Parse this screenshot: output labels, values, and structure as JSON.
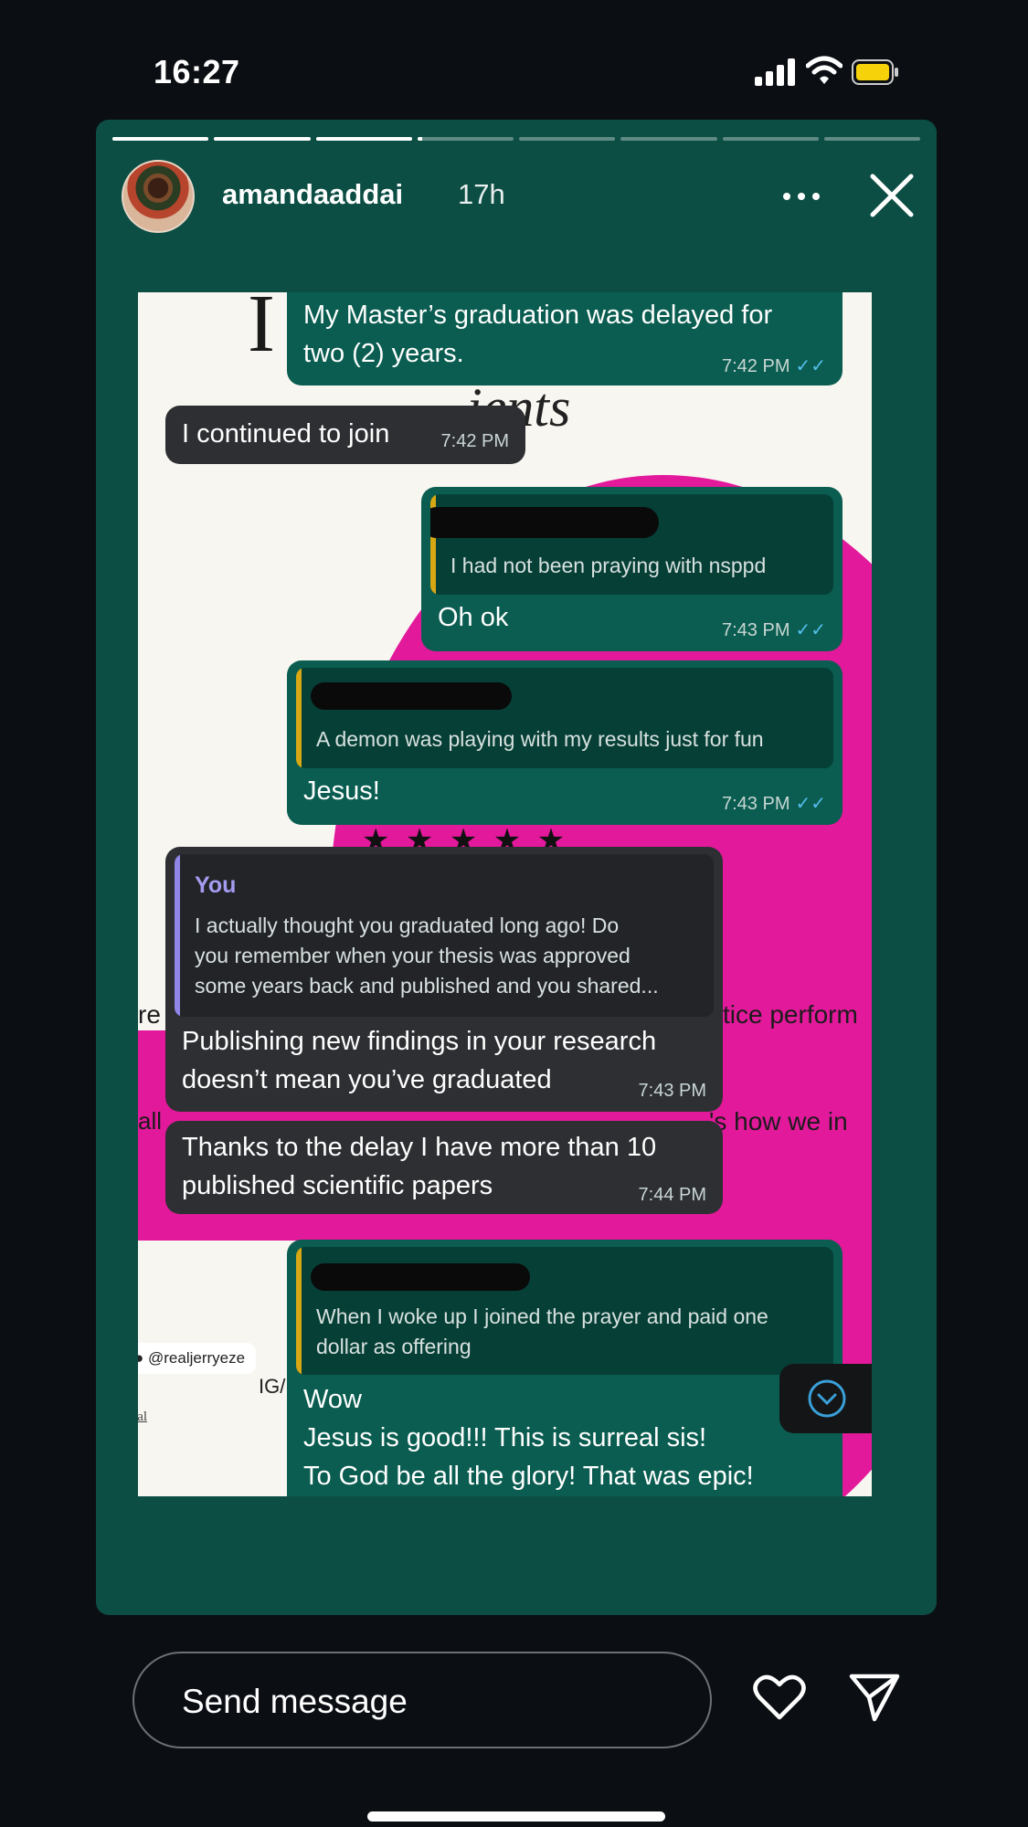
{
  "status_bar": {
    "time": "16:27"
  },
  "story": {
    "progress": {
      "segments": 8,
      "current_segment": 4,
      "current_fraction": 0.05
    },
    "username": "amandaaddai",
    "time_ago": "17h"
  },
  "chat": {
    "messages": [
      {
        "direction": "outgoing",
        "text_lines": [
          "My Master’s graduation was delayed for",
          "two (2) years."
        ],
        "time": "7:42 PM",
        "read": true
      },
      {
        "direction": "incoming",
        "text_lines": [
          "I continued to join"
        ],
        "time": "7:42 PM"
      },
      {
        "direction": "outgoing",
        "quoted": {
          "author_redacted": true,
          "text_lines": [
            "I had not been praying with nsppd"
          ]
        },
        "text_lines": [
          "Oh ok"
        ],
        "time": "7:43 PM",
        "read": true
      },
      {
        "direction": "outgoing",
        "quoted": {
          "author_redacted": true,
          "text_lines": [
            "A demon was playing with my results just for fun"
          ]
        },
        "text_lines": [
          "Jesus!"
        ],
        "time": "7:43 PM",
        "read": true
      },
      {
        "direction": "incoming",
        "quoted": {
          "author": "You",
          "text_lines": [
            "I actually thought you graduated long ago! Do",
            "you remember when your thesis was approved",
            "some years back and published and you shared..."
          ]
        },
        "text_lines": [
          "Publishing new findings in your research",
          "doesn’t mean you’ve graduated"
        ],
        "time": "7:43 PM"
      },
      {
        "direction": "incoming",
        "text_lines": [
          "Thanks to the delay I have more than 10",
          "published scientific papers"
        ],
        "time": "7:44 PM"
      },
      {
        "direction": "outgoing",
        "quoted": {
          "author_redacted": true,
          "text_lines": [
            "When I woke up I joined the prayer and paid one",
            "dollar as offering"
          ]
        },
        "text_lines": [
          "Wow",
          "Jesus is good!!! This is surreal sis!",
          "To God be all the glory! That was epic!"
        ]
      }
    ],
    "background_text": {
      "script": "ients",
      "left_fragment_1": "re",
      "right_fragment_1": "tice perform",
      "left_fragment_2": "all",
      "right_fragment_2": "'s how we in",
      "mention_pill": "@realjerryeze",
      "ig_label": "IG/",
      "mention_link": "@stre                                   al"
    }
  },
  "reply": {
    "placeholder": "Send message"
  },
  "colors": {
    "card_bg": "#0c4e44",
    "outgoing_bubble": "#0a5d50",
    "incoming_bubble": "#2e2f33",
    "read_ticks": "#53bdeb",
    "quote_bar_out": "#d7a814",
    "quote_bar_in": "#8f86e8",
    "pink_bg": "#e2199b"
  }
}
